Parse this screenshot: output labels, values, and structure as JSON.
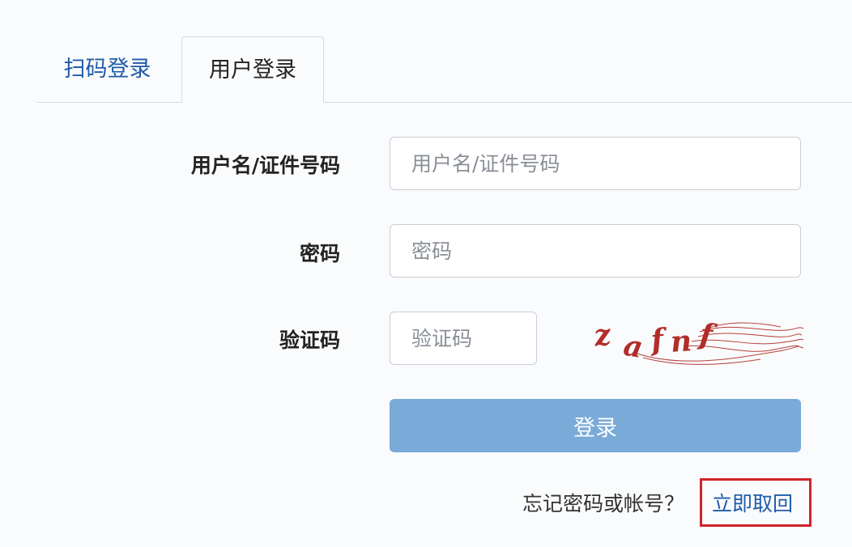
{
  "tabs": [
    {
      "label": "扫码登录"
    },
    {
      "label": "用户登录"
    }
  ],
  "form": {
    "username": {
      "label": "用户名/证件号码",
      "placeholder": "用户名/证件号码"
    },
    "password": {
      "label": "密码",
      "placeholder": "密码"
    },
    "captcha": {
      "label": "验证码",
      "placeholder": "验证码",
      "image_text": "zafnf"
    },
    "login_label": "登录"
  },
  "footer": {
    "forgot_text": "忘记密码或帐号？",
    "recover_label": "立即取回"
  },
  "colors": {
    "link": "#1f5ca8",
    "button": "#7aaad8",
    "highlight": "#d0242b"
  }
}
